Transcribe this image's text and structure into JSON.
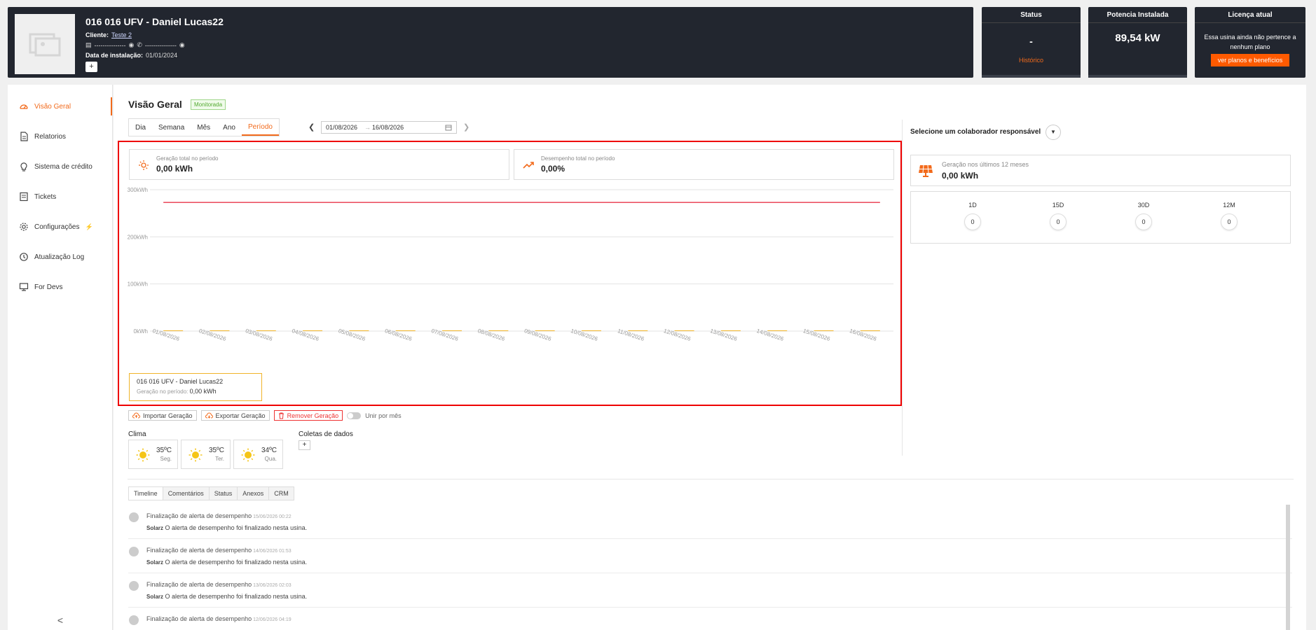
{
  "header": {
    "title": "016 016 UFV - Daniel Lucas22",
    "client_label": "Cliente:",
    "client_value": "Teste 2",
    "masked_id": "---------------",
    "masked_phone": "---------------",
    "install_label": "Data de instalação:",
    "install_value": "01/01/2024",
    "add_label": "+"
  },
  "status_box": {
    "title": "Status",
    "value": "-",
    "link": "Histórico"
  },
  "power_box": {
    "title": "Potencia Instalada",
    "value": "89,54 kW"
  },
  "license_box": {
    "title": "Licença atual",
    "text": "Essa usina ainda não pertence a nenhum plano",
    "button": "ver planos e benefícios"
  },
  "sidebar": {
    "items": [
      {
        "label": "Visão Geral",
        "icon": "gauge-icon"
      },
      {
        "label": "Relatorios",
        "icon": "document-icon"
      },
      {
        "label": "Sistema de crédito",
        "icon": "bulb-icon"
      },
      {
        "label": "Tickets",
        "icon": "ticket-icon"
      },
      {
        "label": "Configurações",
        "icon": "gear-icon"
      },
      {
        "label": "Atualização Log",
        "icon": "history-icon"
      },
      {
        "label": "For Devs",
        "icon": "monitor-icon"
      }
    ],
    "collapse": "<"
  },
  "page": {
    "title": "Visão Geral",
    "badge": "Monitorada"
  },
  "period_tabs": [
    "Dia",
    "Semana",
    "Mês",
    "Ano",
    "Período"
  ],
  "date_range": {
    "start": "01/08/2026",
    "end": "16/08/2026",
    "arrow": "→"
  },
  "kpis": {
    "generation": {
      "label": "Geração total no período",
      "value": "0,00 kWh"
    },
    "performance": {
      "label": "Desempenho total no período",
      "value": "0,00%"
    }
  },
  "chart_data": {
    "type": "bar",
    "categories": [
      "01/08/2026",
      "02/08/2026",
      "03/08/2026",
      "04/08/2026",
      "05/08/2026",
      "06/08/2026",
      "07/08/2026",
      "08/08/2026",
      "09/08/2026",
      "10/08/2026",
      "11/08/2026",
      "12/08/2026",
      "13/08/2026",
      "14/08/2026",
      "15/08/2026",
      "16/08/2026"
    ],
    "series": [
      {
        "name": "016 016 UFV - Daniel Lucas22",
        "values": [
          0,
          0,
          0,
          0,
          0,
          0,
          0,
          0,
          0,
          0,
          0,
          0,
          0,
          0,
          0,
          0
        ]
      }
    ],
    "reference_line": 273,
    "y_ticks": [
      "0kWh",
      "100kWh",
      "200kWh",
      "300kWh"
    ],
    "ylim": [
      0,
      300
    ],
    "grid": true,
    "colors": {
      "bar": "#f0b429",
      "reference": "#e8344a"
    }
  },
  "legend": {
    "name": "016 016 UFV - Daniel Lucas22",
    "gen_label": "Geração no período:",
    "gen_value": "0,00 kWh"
  },
  "actions": {
    "import": "Importar Geração",
    "export": "Exportar Geração",
    "remove": "Remover Geração",
    "toggle": "Unir por mês"
  },
  "clima": {
    "title": "Clima",
    "days": [
      {
        "temp": "35ºC",
        "day": "Seg."
      },
      {
        "temp": "35ºC",
        "day": "Ter."
      },
      {
        "temp": "34ºC",
        "day": "Qua."
      }
    ]
  },
  "coletas": {
    "title": "Coletas de dados",
    "add": "+"
  },
  "right": {
    "select_label": "Selecione um colaborador responsável",
    "gen_label": "Geração nos últimos 12 meses",
    "gen_value": "0,00 kWh",
    "periods": [
      {
        "label": "1D",
        "value": "0"
      },
      {
        "label": "15D",
        "value": "0"
      },
      {
        "label": "30D",
        "value": "0"
      },
      {
        "label": "12M",
        "value": "0"
      }
    ]
  },
  "bottom_tabs": [
    "Timeline",
    "Comentários",
    "Status",
    "Anexos",
    "CRM"
  ],
  "timeline": [
    {
      "title": "Finalização de alerta de desempenho",
      "time": "15/06/2026 00:22",
      "author": "Solarz",
      "text": "O alerta de desempenho foi finalizado nesta usina."
    },
    {
      "title": "Finalização de alerta de desempenho",
      "time": "14/06/2026 01:53",
      "author": "Solarz",
      "text": "O alerta de desempenho foi finalizado nesta usina."
    },
    {
      "title": "Finalização de alerta de desempenho",
      "time": "13/06/2026 02:03",
      "author": "Solarz",
      "text": "O alerta de desempenho foi finalizado nesta usina."
    },
    {
      "title": "Finalização de alerta de desempenho",
      "time": "12/06/2026 04:19",
      "author": "",
      "text": ""
    }
  ],
  "colors": {
    "accent": "#f26a1b",
    "header_bg": "#22262f",
    "success": "#52a930",
    "danger": "#e33333"
  }
}
